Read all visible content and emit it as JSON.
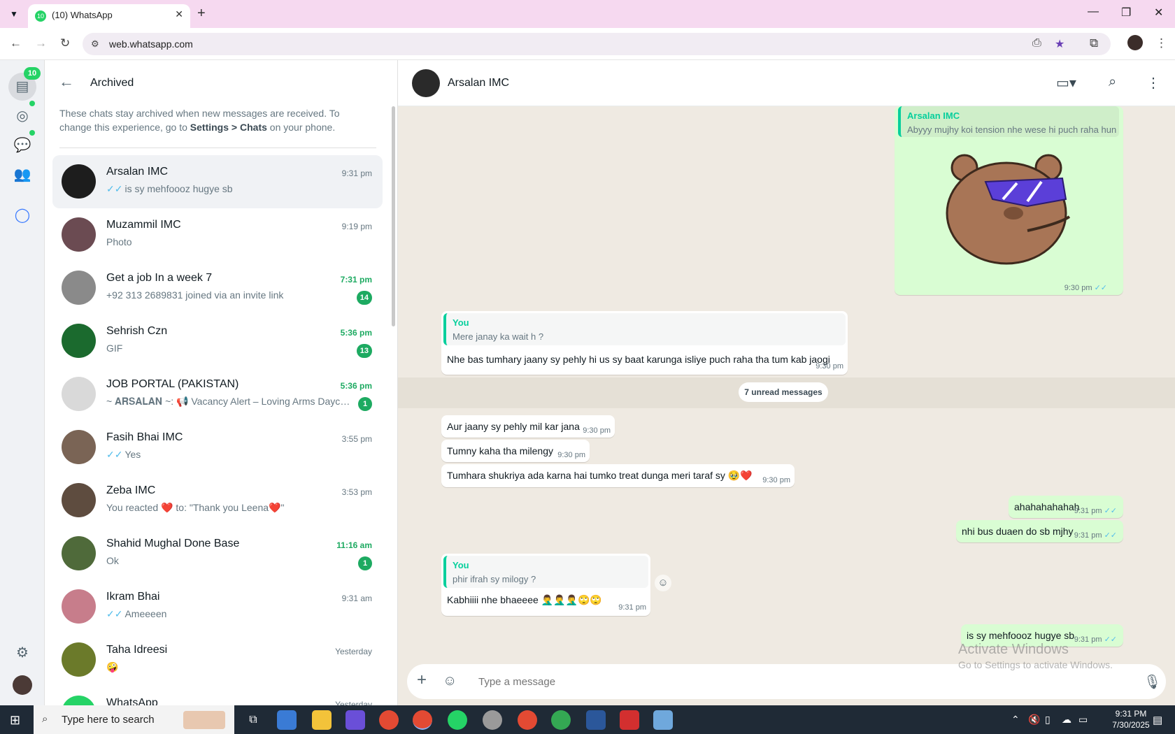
{
  "browser": {
    "tab_title": "(10) WhatsApp",
    "tab_favicon_badge": "10",
    "url": "web.whatsapp.com"
  },
  "rail": {
    "chats_badge": "10"
  },
  "sidebar": {
    "title": "Archived",
    "info_pre": "These chats stay archived when new messages are received. To change this experience, go to ",
    "info_bold1": "Settings",
    "info_mid": " > ",
    "info_bold2": "Chats",
    "info_post": " on your phone.",
    "chats": [
      {
        "name": "Arsalan IMC",
        "preview": "is sy mehfoooz hugye sb",
        "time": "9:31 pm",
        "read_ticks": true,
        "unread": "",
        "avatar_color": "#1d1d1d"
      },
      {
        "name": "Muzammil IMC",
        "preview": "Photo",
        "time": "9:19 pm",
        "read_ticks": false,
        "unread": "",
        "avatar_color": "#6b4b52"
      },
      {
        "name": "Get a job In a week 7",
        "preview": "+92 313 2689831 joined via an invite link",
        "time": "7:31 pm",
        "read_ticks": false,
        "unread": "14",
        "avatar_color": "#8a8a8a"
      },
      {
        "name": "Sehrish Czn",
        "preview": "GIF",
        "time": "5:36 pm",
        "read_ticks": false,
        "unread": "13",
        "avatar_color": "#1b6a2e"
      },
      {
        "name": "JOB PORTAL (PAKISTAN)",
        "preview": "~ 𝐀𝐑𝐒𝐀𝐋𝐀𝐍 ~: 📢 Vacancy Alert – Loving Arms Daycar...",
        "time": "5:36 pm",
        "read_ticks": false,
        "unread": "1",
        "avatar_color": "#d9d9d9"
      },
      {
        "name": "Fasih Bhai IMC",
        "preview": "Yes",
        "time": "3:55 pm",
        "read_ticks": true,
        "unread": "",
        "avatar_color": "#7a6455"
      },
      {
        "name": "Zeba IMC",
        "preview": "You reacted ❤️ to: \"Thank you Leena❤️\"",
        "time": "3:53 pm",
        "read_ticks": false,
        "unread": "",
        "avatar_color": "#5e4c3f"
      },
      {
        "name": "Shahid Mughal Done Base",
        "preview": "Ok",
        "time": "11:16 am",
        "read_ticks": false,
        "unread": "1",
        "avatar_color": "#4f6a3a"
      },
      {
        "name": "Ikram Bhai",
        "preview": "Ameeeen",
        "time": "9:31 am",
        "read_ticks": true,
        "unread": "",
        "avatar_color": "#c77d8b"
      },
      {
        "name": "Taha Idreesi",
        "preview": "🤪",
        "time": "Yesterday",
        "read_ticks": false,
        "unread": "",
        "avatar_color": "#6b7a2a"
      },
      {
        "name": "WhatsApp",
        "preview": "",
        "time": "Yesterday",
        "read_ticks": false,
        "unread": "",
        "avatar_color": "#25d366"
      }
    ]
  },
  "chat": {
    "contact_name": "Arsalan IMC",
    "messages": {
      "sticker_quote_name": "Arsalan IMC",
      "sticker_quote_text": "Abyyy mujhy koi tension nhe wese hi puch raha hun",
      "sticker_time": "9:30 pm",
      "m1_quote_name": "You",
      "m1_quote_text": "Mere janay ka wait h ?",
      "m1_text": "Nhe bas tumhary jaany sy pehly hi us sy baat karunga isliye puch raha tha tum kab jaogi",
      "m1_time": "9:30 pm",
      "unread_divider": "7 unread messages",
      "m2_text": "Aur jaany sy pehly mil kar jana",
      "m2_time": "9:30 pm",
      "m3_text": "Tumny kaha tha milengy",
      "m3_time": "9:30 pm",
      "m4_text": "Tumhara shukriya ada karna hai tumko treat dunga meri taraf sy 🥹❤️",
      "m4_time": "9:30 pm",
      "m5_text": "ahahahahahah",
      "m5_time": "9:31 pm",
      "m6_text": "nhi bus duaen do sb mjhy",
      "m6_time": "9:31 pm",
      "m7_quote_name": "You",
      "m7_quote_text": "phir ifrah sy milogy ?",
      "m7_text": "Kabhiiii nhe bhaeeee 🤦‍♂️🤦‍♂️🤦‍♂️🙄🙄",
      "m7_time": "9:31 pm",
      "m8_text": "is sy mehfoooz hugye sb",
      "m8_time": "9:31 pm"
    },
    "composer_placeholder": "Type a message"
  },
  "watermark": {
    "line1": "Activate Windows",
    "line2": "Go to Settings to activate Windows."
  },
  "taskbar": {
    "search_placeholder": "Type here to search",
    "time": "9:31 PM",
    "date": "7/30/2025"
  },
  "colors": {
    "accent_green": "#25d366",
    "unread_green": "#1daa61",
    "out_bubble": "#d9fdd3",
    "tick_blue": "#53bdeb"
  }
}
